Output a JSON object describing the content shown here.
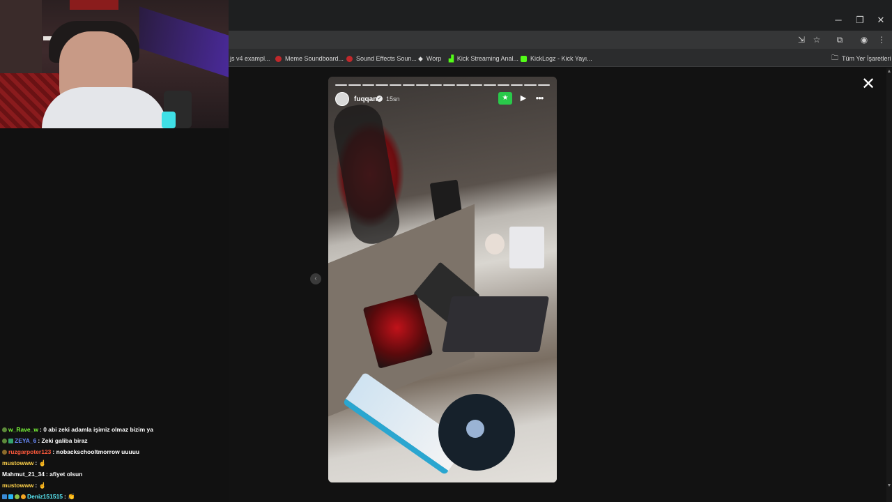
{
  "window": {
    "minimize": "─",
    "restore": "❐",
    "close": "✕"
  },
  "bookmarks": [
    {
      "label": "js v4 exampl...",
      "color": "#2b2c2d"
    },
    {
      "label": "Meme Soundboard...",
      "color": "#c0282b"
    },
    {
      "label": "Sound Effects Soun...",
      "color": "#c0282b"
    },
    {
      "label": "Worp",
      "color": "#dddddd"
    },
    {
      "label": "Kick Streaming Anal...",
      "color": "#53fc18"
    },
    {
      "label": "KickLogz - Kick Yayı...",
      "color": "#53fc18"
    }
  ],
  "all_bookmarks": "Tüm Yer İşaretleri",
  "story": {
    "username": "fuqqan",
    "time": "15sn",
    "segments": 16
  },
  "chat": [
    {
      "user": "w_Rave_w",
      "message": " : 0 abi zeki adamla işimiz olmaz bizim ya",
      "user_color": "#7cfc3a"
    },
    {
      "user": "ZEYA_6",
      "message": " : Zeki galiba biraz",
      "user_color": "#6a8cff"
    },
    {
      "user": "ruzgarpoter123",
      "message": " : nobackschooltmorrow uuuuu",
      "user_color": "#ff5a3c"
    },
    {
      "user": "mustowww",
      "message": " : ☝",
      "user_color": "#ffd24a"
    },
    {
      "user": "Mahmut_21_34",
      "message": " : afiyet olsun",
      "user_color": "#ffffff"
    },
    {
      "user": "mustowww",
      "message": " : ☝",
      "user_color": "#ffd24a"
    },
    {
      "user": "Deniz151515",
      "message": " : 👏",
      "user_color": "#5cf2ff"
    }
  ],
  "colors": {
    "close_friends": "#29c94a",
    "chrome_bg": "#1e1f20"
  }
}
